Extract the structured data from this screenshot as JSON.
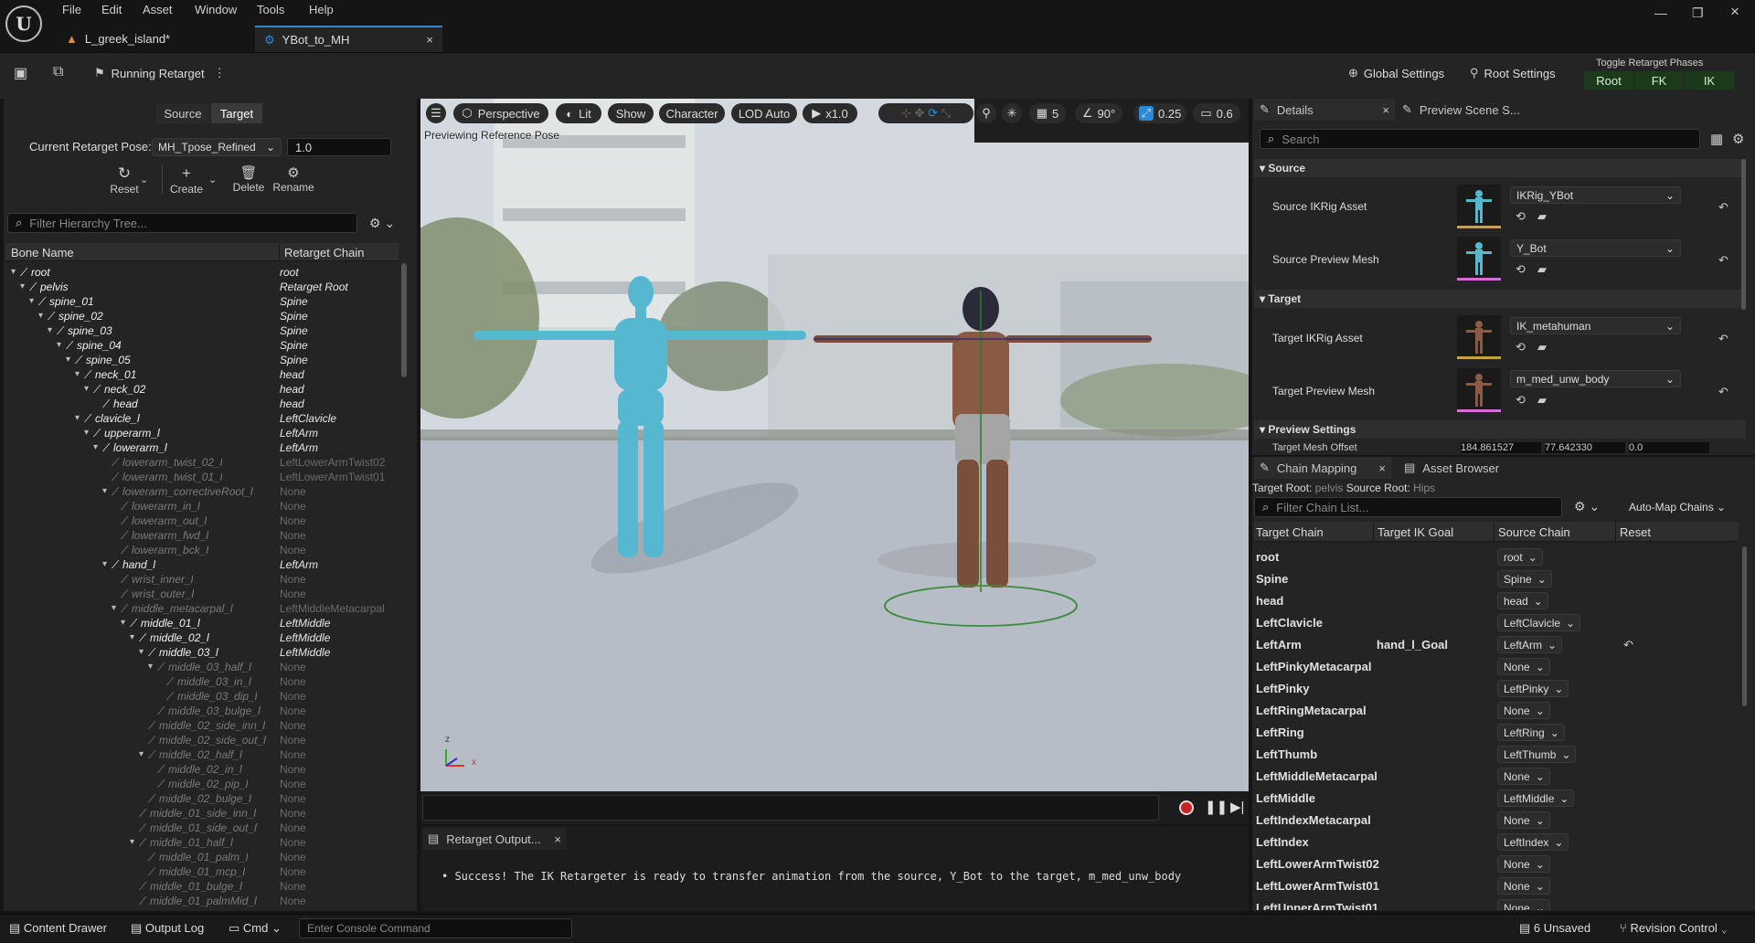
{
  "menu": [
    "File",
    "Edit",
    "Asset",
    "Window",
    "Tools",
    "Help"
  ],
  "tabs": [
    {
      "label": "L_greek_island*"
    },
    {
      "label": "YBot_to_MH"
    }
  ],
  "toolbar": {
    "running_label": "Running Retarget",
    "global_settings": "Global Settings",
    "root_settings": "Root Settings",
    "phases_title": "Toggle Retarget Phases",
    "phases": [
      "Root",
      "FK",
      "IK"
    ]
  },
  "left": {
    "source_tab": "Source",
    "target_tab": "Target",
    "pose_label": "Current Retarget Pose:",
    "pose_value": "MH_Tpose_Refined",
    "pose_amount": "1.0",
    "actions": [
      "Reset",
      "Create",
      "Delete",
      "Rename"
    ],
    "filter_placeholder": "Filter Hierarchy Tree...",
    "col_bone": "Bone Name",
    "col_chain": "Retarget Chain",
    "rows": [
      {
        "bone": "root",
        "chain": "root",
        "depth": 0,
        "on": true,
        "exp": true
      },
      {
        "bone": "pelvis",
        "chain": "Retarget Root",
        "depth": 1,
        "on": true,
        "exp": true
      },
      {
        "bone": "spine_01",
        "chain": "Spine",
        "depth": 2,
        "on": true,
        "exp": true
      },
      {
        "bone": "spine_02",
        "chain": "Spine",
        "depth": 3,
        "on": true,
        "exp": true
      },
      {
        "bone": "spine_03",
        "chain": "Spine",
        "depth": 4,
        "on": true,
        "exp": true
      },
      {
        "bone": "spine_04",
        "chain": "Spine",
        "depth": 5,
        "on": true,
        "exp": true
      },
      {
        "bone": "spine_05",
        "chain": "Spine",
        "depth": 6,
        "on": true,
        "exp": true
      },
      {
        "bone": "neck_01",
        "chain": "head",
        "depth": 7,
        "on": true,
        "exp": true
      },
      {
        "bone": "neck_02",
        "chain": "head",
        "depth": 8,
        "on": true,
        "exp": true
      },
      {
        "bone": "head",
        "chain": "head",
        "depth": 9,
        "on": true,
        "exp": false
      },
      {
        "bone": "clavicle_l",
        "chain": "LeftClavicle",
        "depth": 7,
        "on": true,
        "exp": true
      },
      {
        "bone": "upperarm_l",
        "chain": "LeftArm",
        "depth": 8,
        "on": true,
        "exp": true
      },
      {
        "bone": "lowerarm_l",
        "chain": "LeftArm",
        "depth": 9,
        "on": true,
        "exp": true
      },
      {
        "bone": "lowerarm_twist_02_l",
        "chain": "LeftLowerArmTwist02",
        "depth": 10,
        "on": false,
        "exp": false
      },
      {
        "bone": "lowerarm_twist_01_l",
        "chain": "LeftLowerArmTwist01",
        "depth": 10,
        "on": false,
        "exp": false
      },
      {
        "bone": "lowerarm_correctiveRoot_l",
        "chain": "None",
        "depth": 10,
        "on": false,
        "exp": true
      },
      {
        "bone": "lowerarm_in_l",
        "chain": "None",
        "depth": 11,
        "on": false,
        "exp": false
      },
      {
        "bone": "lowerarm_out_l",
        "chain": "None",
        "depth": 11,
        "on": false,
        "exp": false
      },
      {
        "bone": "lowerarm_fwd_l",
        "chain": "None",
        "depth": 11,
        "on": false,
        "exp": false
      },
      {
        "bone": "lowerarm_bck_l",
        "chain": "None",
        "depth": 11,
        "on": false,
        "exp": false
      },
      {
        "bone": "hand_l",
        "chain": "LeftArm",
        "depth": 10,
        "on": true,
        "exp": true
      },
      {
        "bone": "wrist_inner_l",
        "chain": "None",
        "depth": 11,
        "on": false,
        "exp": false
      },
      {
        "bone": "wrist_outer_l",
        "chain": "None",
        "depth": 11,
        "on": false,
        "exp": false
      },
      {
        "bone": "middle_metacarpal_l",
        "chain": "LeftMiddleMetacarpal",
        "depth": 11,
        "on": false,
        "exp": true
      },
      {
        "bone": "middle_01_l",
        "chain": "LeftMiddle",
        "depth": 12,
        "on": true,
        "exp": true
      },
      {
        "bone": "middle_02_l",
        "chain": "LeftMiddle",
        "depth": 13,
        "on": true,
        "exp": true
      },
      {
        "bone": "middle_03_l",
        "chain": "LeftMiddle",
        "depth": 14,
        "on": true,
        "exp": true
      },
      {
        "bone": "middle_03_half_l",
        "chain": "None",
        "depth": 15,
        "on": false,
        "exp": true
      },
      {
        "bone": "middle_03_in_l",
        "chain": "None",
        "depth": 16,
        "on": false,
        "exp": false
      },
      {
        "bone": "middle_03_dip_l",
        "chain": "None",
        "depth": 16,
        "on": false,
        "exp": false
      },
      {
        "bone": "middle_03_bulge_l",
        "chain": "None",
        "depth": 15,
        "on": false,
        "exp": false
      },
      {
        "bone": "middle_02_side_inn_l",
        "chain": "None",
        "depth": 14,
        "on": false,
        "exp": false
      },
      {
        "bone": "middle_02_side_out_l",
        "chain": "None",
        "depth": 14,
        "on": false,
        "exp": false
      },
      {
        "bone": "middle_02_half_l",
        "chain": "None",
        "depth": 14,
        "on": false,
        "exp": true
      },
      {
        "bone": "middle_02_in_l",
        "chain": "None",
        "depth": 15,
        "on": false,
        "exp": false
      },
      {
        "bone": "middle_02_pip_l",
        "chain": "None",
        "depth": 15,
        "on": false,
        "exp": false
      },
      {
        "bone": "middle_02_bulge_l",
        "chain": "None",
        "depth": 14,
        "on": false,
        "exp": false
      },
      {
        "bone": "middle_01_side_inn_l",
        "chain": "None",
        "depth": 13,
        "on": false,
        "exp": false
      },
      {
        "bone": "middle_01_side_out_l",
        "chain": "None",
        "depth": 13,
        "on": false,
        "exp": false
      },
      {
        "bone": "middle_01_half_l",
        "chain": "None",
        "depth": 13,
        "on": false,
        "exp": true
      },
      {
        "bone": "middle_01_palm_l",
        "chain": "None",
        "depth": 14,
        "on": false,
        "exp": false
      },
      {
        "bone": "middle_01_mcp_l",
        "chain": "None",
        "depth": 14,
        "on": false,
        "exp": false
      },
      {
        "bone": "middle_01_bulge_l",
        "chain": "None",
        "depth": 13,
        "on": false,
        "exp": false
      },
      {
        "bone": "middle_01_palmMid_l",
        "chain": "None",
        "depth": 13,
        "on": false,
        "exp": false
      }
    ]
  },
  "viewport": {
    "perspective": "Perspective",
    "lit": "Lit",
    "show": "Show",
    "character": "Character",
    "lod": "LOD Auto",
    "speed": "x1.0",
    "grid": "5",
    "angle": "90°",
    "scale": "0.25",
    "camera": "0.6",
    "overlay": "Previewing Reference Pose"
  },
  "output": {
    "tab": "Retarget Output...",
    "message": "Success! The IK Retargeter is ready to transfer animation from the source, Y_Bot to the target, m_med_unw_body"
  },
  "details": {
    "tab": "Details",
    "tab2": "Preview Scene S...",
    "search_placeholder": "Search",
    "source_section": "Source",
    "target_section": "Target",
    "preview_section": "Preview Settings",
    "source_ikrig_label": "Source IKRig Asset",
    "source_ikrig": "IKRig_YBot",
    "source_mesh_label": "Source Preview Mesh",
    "source_mesh": "Y_Bot",
    "target_ikrig_label": "Target IKRig Asset",
    "target_ikrig": "IK_metahuman",
    "target_mesh_label": "Target Preview Mesh",
    "target_mesh": "m_med_unw_body",
    "offset_label": "Target Mesh Offset",
    "offset_values": [
      "184.861527",
      "77.642330",
      "0.0"
    ]
  },
  "chains": {
    "tab": "Chain Mapping",
    "tab2": "Asset Browser",
    "target_root_label": "Target Root:",
    "target_root": "pelvis",
    "source_root_label": "Source Root:",
    "source_root": "Hips",
    "filter_placeholder": "Filter Chain List...",
    "automap": "Auto-Map Chains",
    "cols": [
      "Target Chain",
      "Target IK Goal",
      "Source Chain",
      "Reset"
    ],
    "rows": [
      {
        "target": "root",
        "goal": "",
        "source": "root",
        "reset": false
      },
      {
        "target": "Spine",
        "goal": "",
        "source": "Spine",
        "reset": false
      },
      {
        "target": "head",
        "goal": "",
        "source": "head",
        "reset": false
      },
      {
        "target": "LeftClavicle",
        "goal": "",
        "source": "LeftClavicle",
        "reset": false
      },
      {
        "target": "LeftArm",
        "goal": "hand_l_Goal",
        "source": "LeftArm",
        "reset": true
      },
      {
        "target": "LeftPinkyMetacarpal",
        "goal": "",
        "source": "None",
        "reset": false
      },
      {
        "target": "LeftPinky",
        "goal": "",
        "source": "LeftPinky",
        "reset": false
      },
      {
        "target": "LeftRingMetacarpal",
        "goal": "",
        "source": "None",
        "reset": false
      },
      {
        "target": "LeftRing",
        "goal": "",
        "source": "LeftRing",
        "reset": false
      },
      {
        "target": "LeftThumb",
        "goal": "",
        "source": "LeftThumb",
        "reset": false
      },
      {
        "target": "LeftMiddleMetacarpal",
        "goal": "",
        "source": "None",
        "reset": false
      },
      {
        "target": "LeftMiddle",
        "goal": "",
        "source": "LeftMiddle",
        "reset": false
      },
      {
        "target": "LeftIndexMetacarpal",
        "goal": "",
        "source": "None",
        "reset": false
      },
      {
        "target": "LeftIndex",
        "goal": "",
        "source": "LeftIndex",
        "reset": false
      },
      {
        "target": "LeftLowerArmTwist02",
        "goal": "",
        "source": "None",
        "reset": false
      },
      {
        "target": "LeftLowerArmTwist01",
        "goal": "",
        "source": "None",
        "reset": false
      },
      {
        "target": "LeftUpperArmTwist01",
        "goal": "",
        "source": "None",
        "reset": false
      }
    ]
  },
  "bottom": {
    "content_drawer": "Content Drawer",
    "output_log": "Output Log",
    "cmd": "Cmd",
    "console_placeholder": "Enter Console Command",
    "unsaved": "6 Unsaved",
    "revision": "Revision Control"
  },
  "colors": {
    "accent": "#2a8ad8",
    "phase_green": "#1a3a1a",
    "source_mannequin": "#56b8d0"
  }
}
